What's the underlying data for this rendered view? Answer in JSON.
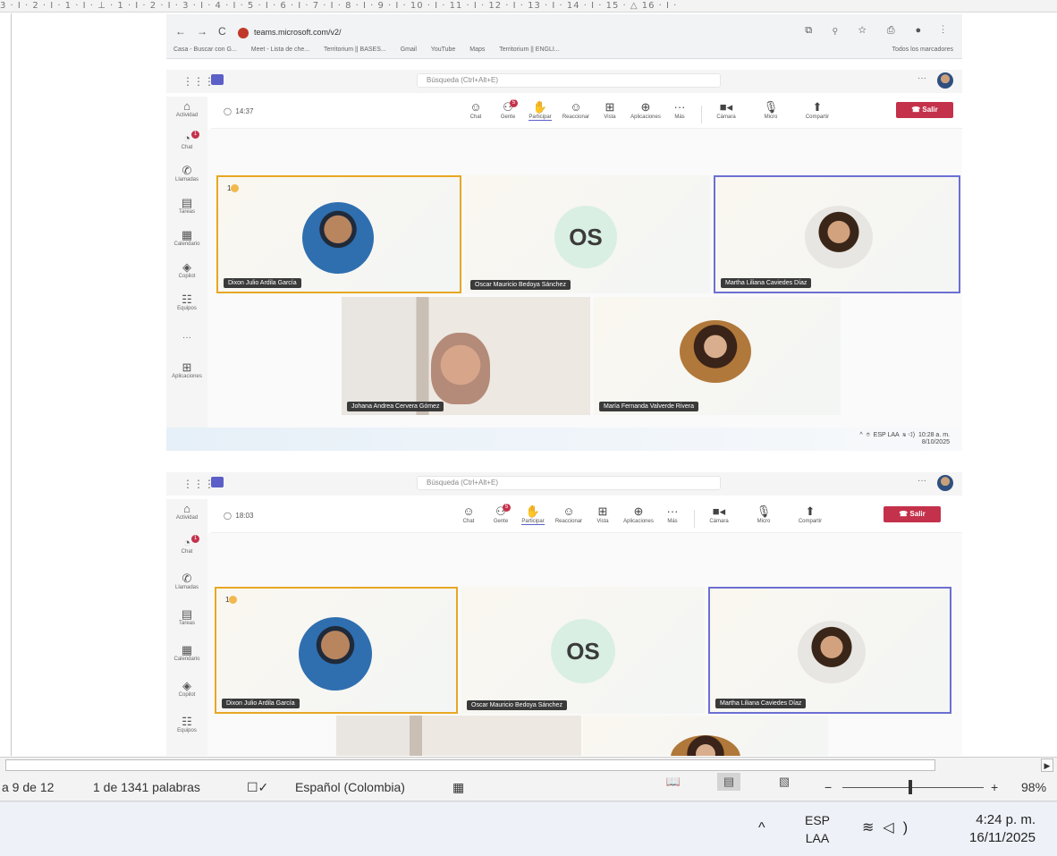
{
  "ruler": "3 · I · 2 · I · 1 · I · ⊥ · 1 · I · 2 · I · 3 · I · 4 · I · 5 · I · 6 · I · 7 · I · 8 · I · 9 · I · 10 · I · 11 · I · 12 · I · 13 · I · 14 · I · 15 · △ 16 · I ·",
  "browser": {
    "url": "teams.microsoft.com/v2/",
    "back": "←",
    "forward": "→",
    "reload": "C",
    "right_icons": "⧉ ⚲ ☆ ⎙ ● ⋮",
    "bookmarks": [
      "Casa - Buscar con G...",
      "Meet - Lista de che...",
      "Territorium || BASES...",
      "Gmail",
      "YouTube",
      "Maps",
      "Territorium || ENGLI..."
    ],
    "all_bookmarks": "Todos los marcadores"
  },
  "teams": {
    "search_placeholder": "Búsqueda (Ctrl+Alt+E)",
    "search_placeholder_2": "Búsqueda (Ctrl+Alt+E)",
    "more": "···",
    "rail": [
      {
        "label": "Actividad",
        "icon": "bell-icon",
        "glyph": "🔔"
      },
      {
        "label": "Chat",
        "icon": "chat-icon",
        "glyph": "💬",
        "badge": "1"
      },
      {
        "label": "Llamadas",
        "icon": "phone-icon",
        "glyph": "✆"
      },
      {
        "label": "Tareas",
        "icon": "tasks-icon",
        "glyph": "▤"
      },
      {
        "label": "Calendario",
        "icon": "calendar-icon",
        "glyph": "▦"
      },
      {
        "label": "Copilot",
        "icon": "copilot-icon",
        "glyph": "◈"
      },
      {
        "label": "Equipos",
        "icon": "teams-icon",
        "glyph": "☷"
      },
      {
        "label": "···",
        "icon": "more-icon",
        "glyph": ""
      },
      {
        "label": "Aplicaciones",
        "icon": "apps-icon",
        "glyph": "⊞"
      }
    ],
    "meeting_1": {
      "timer": "14:37"
    },
    "meeting_2": {
      "timer": "18:03"
    },
    "tools": [
      {
        "label": "Chat",
        "glyph": "☺"
      },
      {
        "label": "Gente",
        "glyph": "👥",
        "badge": "5"
      },
      {
        "label": "Participar",
        "glyph": "✋"
      },
      {
        "label": "Reaccionar",
        "glyph": "☺"
      },
      {
        "label": "Vista",
        "glyph": "⊞"
      },
      {
        "label": "Aplicaciones",
        "glyph": "⊕"
      },
      {
        "label": "Más",
        "glyph": "···"
      },
      {
        "label": "Cámara",
        "glyph": "■"
      },
      {
        "label": "Micro",
        "glyph": "🎤"
      },
      {
        "label": "Compartir",
        "glyph": "⬆"
      }
    ],
    "leave_label": "Salir",
    "hand_count": "1",
    "participants": {
      "p1": "Dixon Julio Ardila García",
      "p2": "Oscar Mauricio Bedoya Sánchez",
      "p3": "Martha Liliana Caviedes Díaz",
      "p4": "Johana Andrea Cervera Gómez",
      "p5": "María Fernanda Valverde Rivera",
      "p2_initials": "OS"
    },
    "shot_taskbar": {
      "lang": "ESP",
      "lang2": "LAA",
      "time": "10:28 a. m.",
      "date": "8/10/2025"
    }
  },
  "word_status": {
    "page": "a 9 de 12",
    "words": "1 de 1341 palabras",
    "language": "Español (Colombia)",
    "zoom": "98%",
    "zoom_minus": "−",
    "zoom_plus": "+"
  },
  "taskbar": {
    "chevron": "^",
    "lang": "ESP",
    "lang2": "LAA",
    "time": "4:24 p. m.",
    "date": "16/11/2025"
  }
}
